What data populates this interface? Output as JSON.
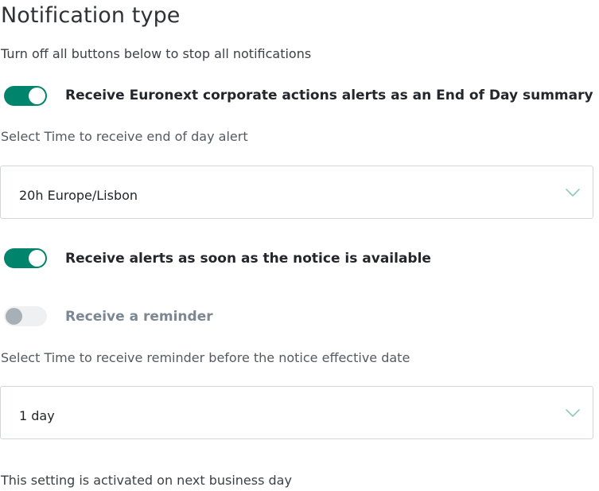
{
  "header": {
    "title": "Notification type",
    "subtitle": "Turn off all buttons below to stop all notifications"
  },
  "toggles": [
    {
      "label": "Receive Euronext corporate actions alerts as an End of Day summary",
      "enabled": true
    },
    {
      "label": "Receive alerts as soon as the notice is available",
      "enabled": true
    },
    {
      "label": "Receive a reminder",
      "enabled": false
    }
  ],
  "end_of_day": {
    "label": "Select Time to receive end of day alert",
    "selected": "20h Europe/Lisbon"
  },
  "reminder": {
    "label": "Select Time to receive reminder before the notice effective date",
    "selected": "1 day"
  },
  "footer": {
    "note": "This setting is activated on next business day"
  },
  "colors": {
    "toggle_on": "#00856d",
    "toggle_off_track": "#eef0f2",
    "toggle_off_knob": "#a7afb7",
    "chevron": "#8fcabc"
  },
  "icons": {
    "dropdown": "chevron-down-icon"
  }
}
